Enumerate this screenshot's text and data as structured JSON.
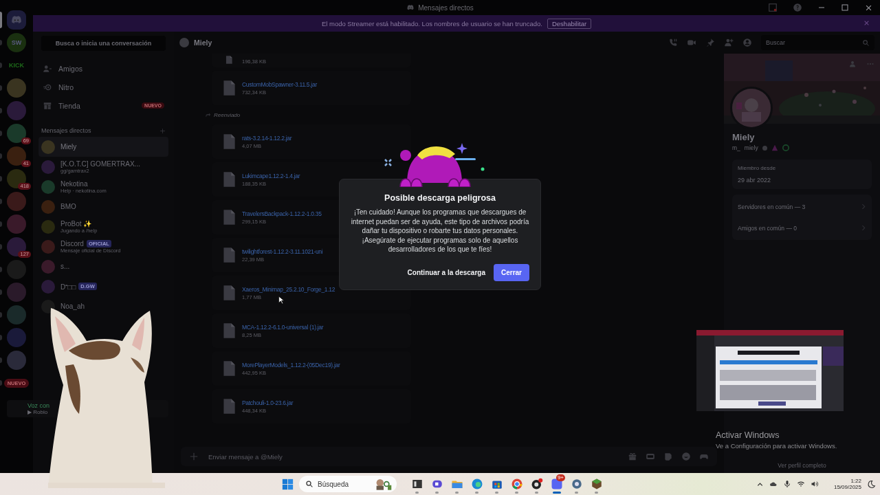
{
  "window": {
    "title": "Mensajes directos"
  },
  "banner": {
    "text": "El modo Streamer está habilitado. Los nombres de usuario se han truncado.",
    "button": "Deshabilitar"
  },
  "servers": [
    {
      "kind": "home",
      "selected": true
    },
    {
      "kind": "avatar",
      "label": "SW",
      "selected": false
    },
    {
      "kind": "text",
      "label": "KICK",
      "selected": false
    },
    {
      "kind": "avatar",
      "selected": false
    },
    {
      "kind": "avatar",
      "selected": false
    },
    {
      "kind": "avatar",
      "badge": "69",
      "selected": false
    },
    {
      "kind": "avatar",
      "badge": "41",
      "selected": false
    },
    {
      "kind": "avatar",
      "badge": "418",
      "selected": false
    },
    {
      "kind": "avatar",
      "selected": false
    },
    {
      "kind": "avatar",
      "selected": false
    },
    {
      "kind": "avatar",
      "badge": "127",
      "selected": false
    },
    {
      "kind": "avatar",
      "selected": false
    },
    {
      "kind": "avatar",
      "selected": false
    },
    {
      "kind": "avatar",
      "selected": false
    },
    {
      "kind": "avatar",
      "selected": false
    },
    {
      "kind": "avatar",
      "selected": false
    },
    {
      "kind": "pill",
      "label": "NUEVO",
      "selected": false
    }
  ],
  "dm_sidebar": {
    "search": "Busca o inicia una conversación",
    "nav": [
      {
        "kind": "friends",
        "label": "Amigos"
      },
      {
        "kind": "nitro",
        "label": "Nitro"
      },
      {
        "kind": "shop",
        "label": "Tienda",
        "badge": "NUEVO"
      }
    ],
    "section": "Mensajes directos",
    "conversations": [
      {
        "name": "Miely",
        "selected": true
      },
      {
        "name": "[K.O.T.C] GOMERTRAX...",
        "status": "gg/gamtrax2",
        "selected": false
      },
      {
        "name": "Nekotina",
        "status": "Help · nekotina.com",
        "selected": false
      },
      {
        "name": "BMO",
        "selected": false
      },
      {
        "name": "ProBot ✨",
        "status": "Jugando a /help",
        "selected": false
      },
      {
        "name": "Discord",
        "tag": "OFICIAL",
        "status": "Mensaje oficial de Discord",
        "selected": false
      },
      {
        "name": "s...",
        "selected": false
      },
      {
        "name": "D⁼□□",
        "tag": "D.GW",
        "selected": false
      },
      {
        "name": "Noa_ah",
        "selected": false
      }
    ],
    "voice": {
      "title": "Voz con",
      "subtitle": "▶ Roblo"
    }
  },
  "chat": {
    "recipient": "Miely",
    "search": "Buscar",
    "messages": [
      {
        "kind": "file",
        "size": "196,38 KB"
      },
      {
        "kind": "file",
        "name": "CustomMobSpawner-3.11.5.jar",
        "size": "732,34 KB"
      },
      {
        "kind": "label",
        "text": "Reenviado"
      },
      {
        "kind": "file",
        "name": "rats-3.2.14-1.12.2.jar",
        "size": "4,07 MB"
      },
      {
        "kind": "file",
        "name": "Lukimcape1.12.2-1.4.jar",
        "size": "188,35 KB"
      },
      {
        "kind": "file",
        "name": "TravelersBackpack-1.12.2-1.0.35",
        "size": "299,15 KB"
      },
      {
        "kind": "file",
        "name": "twilightforest-1.12.2-3.11.1021-uni",
        "size": "22,39 MB"
      },
      {
        "kind": "file",
        "name": "Xaeros_Minimap_25.2.10_Forge_1.12",
        "size": "1,77 MB"
      },
      {
        "kind": "file",
        "name": "MCA-1.12.2-6.1.0-universal (1).jar",
        "size": "8,25 MB"
      },
      {
        "kind": "file",
        "name": "MorePlayerModels_1.12.2-(05Dec19).jar",
        "size": "442,95 KB"
      },
      {
        "kind": "file",
        "name": "Patchouli-1.0-23.6.jar",
        "size": "448,34 KB"
      }
    ],
    "composer": "Enviar mensaje a @Miely"
  },
  "profile": {
    "name": "Miely",
    "tag": "m_",
    "username": "miely",
    "member_label": "Miembro desde",
    "member_since": "29 abr 2022",
    "rows": [
      "Servidores en común — 3",
      "Amigos en común — 0"
    ],
    "link": "Ver perfil completo"
  },
  "dialog": {
    "title": "Posible descarga peligrosa",
    "body": "¡Ten cuidado! Aunque los programas que descargues de internet puedan ser de ayuda, este tipo de archivos podría dañar tu dispositivo o robarte tus datos personales. ¡Asegúrate de ejecutar programas solo de aquellos desarrolladores de los que te fíes!",
    "secondary": "Continuar a la descarga",
    "primary": "Cerrar"
  },
  "activation": {
    "title": "Activar Windows",
    "subtitle": "Ve a Configuración para activar Windows."
  },
  "taskbar": {
    "search": "Búsqueda",
    "time": "1:22",
    "date": "15/09/2025",
    "apps": [
      {
        "kind": "files",
        "active": false
      },
      {
        "kind": "meet",
        "active": false
      },
      {
        "kind": "folder",
        "active": false
      },
      {
        "kind": "edge",
        "active": false
      },
      {
        "kind": "store",
        "active": false
      },
      {
        "kind": "chrome",
        "active": false
      },
      {
        "kind": "obs",
        "active": false
      },
      {
        "kind": "discord",
        "active": true,
        "badge": "9+"
      },
      {
        "kind": "settings",
        "active": false
      },
      {
        "kind": "block",
        "active": false
      }
    ]
  }
}
